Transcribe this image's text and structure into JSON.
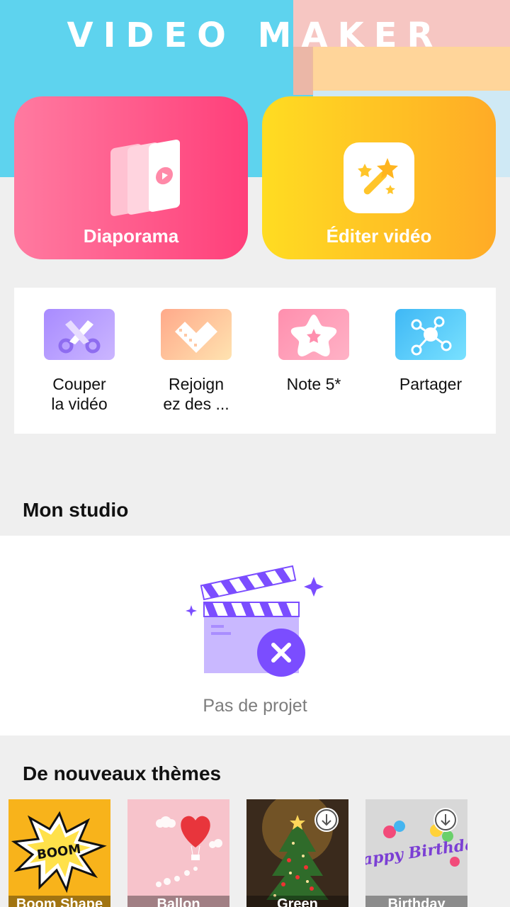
{
  "app_title": "VIDEO MAKER",
  "cards": {
    "slideshow_label": "Diaporama",
    "edit_video_label": "Éditer vidéo"
  },
  "tools": [
    {
      "label_line1": "Couper",
      "label_line2": "la vidéo",
      "icon": "scissors-icon"
    },
    {
      "label_line1": "Rejoign",
      "label_line2": "ez des ...",
      "icon": "film-heart-icon"
    },
    {
      "label_line1": "Note 5*",
      "label_line2": "",
      "icon": "star-rate-icon"
    },
    {
      "label_line1": "Partager",
      "label_line2": "",
      "icon": "share-icon"
    }
  ],
  "studio": {
    "title": "Mon studio",
    "empty_text": "Pas de projet"
  },
  "themes": {
    "title": "De nouveaux thèmes",
    "items": [
      {
        "name": "Boom Shape",
        "downloadable": false,
        "art_text": "BOOM"
      },
      {
        "name": "Ballon",
        "downloadable": false
      },
      {
        "name": "Green",
        "downloadable": true
      },
      {
        "name": "Birthday",
        "downloadable": true,
        "art_text": "Happy Birthday"
      }
    ]
  },
  "colors": {
    "hero_blue": "#5ed3ee",
    "pink_card": "#ff3f7a",
    "yellow_card": "#ffab26",
    "accent_purple": "#7b4dff"
  }
}
